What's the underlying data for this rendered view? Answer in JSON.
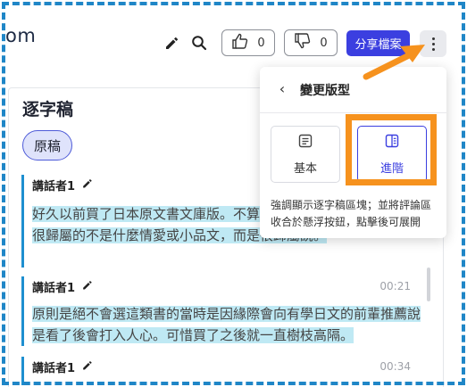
{
  "app": {
    "logo_fragment": "om"
  },
  "toolbar": {
    "edit_icon": "pencil-icon",
    "search_icon": "search-icon",
    "like_count": "0",
    "dislike_count": "0",
    "share_label": "分享檔案",
    "more_icon": "vertical-dots-icon"
  },
  "transcript": {
    "title": "逐字稿",
    "chip_label": "原稿",
    "segments": [
      {
        "speaker": "講話者1",
        "time": "",
        "text": "好久以前買了日本原文書文庫版。不算是什麼情慾或小品文，而是很歸屬的不是什麼情愛或小品文，而是很歸屬說。"
      },
      {
        "speaker": "講話者1",
        "time": "00:21",
        "text": "原則是絕不會選這類書的當時是因緣際會向有學日文的前輩推薦說是看了後會打入人心。可惜買了之後就一直樹枝高隔。"
      },
      {
        "speaker": "講話者1",
        "time": "00:34",
        "text": ""
      }
    ]
  },
  "layout_menu": {
    "title": "變更版型",
    "options": [
      {
        "label": "基本",
        "icon": "document-icon",
        "selected": false
      },
      {
        "label": "進階",
        "icon": "book-icon",
        "selected": true
      }
    ],
    "description": "強調顯示逐字稿區塊；並將評論區收合於懸浮按鈕，點擊後可展開"
  },
  "colors": {
    "accent": "#3b3fe0",
    "highlight": "#bfe9f4",
    "annotation": "#f6921e",
    "frame": "#1f86c7"
  }
}
